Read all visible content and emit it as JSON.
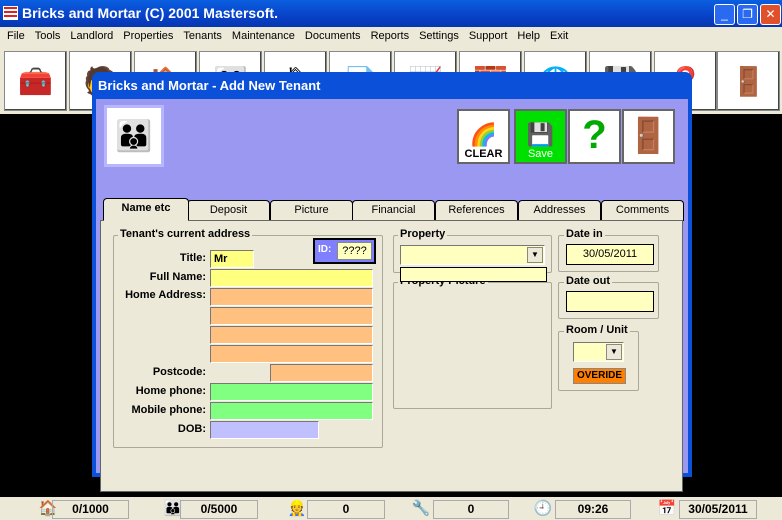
{
  "app": {
    "title": "Bricks and Mortar (C) 2001 Mastersoft."
  },
  "menu": [
    "File",
    "Tools",
    "Landlord",
    "Properties",
    "Tenants",
    "Maintenance",
    "Documents",
    "Reports",
    "Settings",
    "Support",
    "Help",
    "Exit"
  ],
  "toolbar": {
    "icons": [
      "toolbox-icon",
      "landlord-icon",
      "house-icon",
      "tenants-icon",
      "properties-icon",
      "documents-icon",
      "reports-icon",
      "bricks-icon",
      "globe-icon",
      "disk-icon",
      "help-icon",
      "exit-door-icon"
    ]
  },
  "dialog": {
    "title": "Bricks and Mortar - Add New Tenant",
    "buttons": {
      "clear": "CLEAR",
      "save": "Save"
    },
    "tabs": [
      "Name etc",
      "Deposit",
      "Picture",
      "Financial",
      "References",
      "Addresses",
      "Comments"
    ],
    "active_tab": "Name etc",
    "address_group": "Tenant's current address",
    "id_label": "ID:",
    "id_value": "????",
    "labels": {
      "title": "Title:",
      "full_name": "Full Name:",
      "home_address": "Home Address:",
      "postcode": "Postcode:",
      "home_phone": "Home phone:",
      "mobile_phone": "Mobile phone:",
      "dob": "DOB:"
    },
    "values": {
      "title": "Mr",
      "full_name": "",
      "address1": "",
      "address2": "",
      "address3": "",
      "address4": "",
      "postcode": "",
      "home_phone": "",
      "mobile_phone": "",
      "dob": ""
    },
    "property_group": "Property",
    "property_value": "",
    "property_picture": "Property Picture",
    "date_in_label": "Date in",
    "date_in": "30/05/2011",
    "date_out_label": "Date out",
    "date_out": "",
    "room_label": "Room / Unit",
    "room_value": "",
    "override": "OVERIDE"
  },
  "status": [
    {
      "icon": "house-icon",
      "value": "0/1000"
    },
    {
      "icon": "tenants-icon",
      "value": "0/5000"
    },
    {
      "icon": "worker-icon",
      "value": "0"
    },
    {
      "icon": "drill-icon",
      "value": "0"
    },
    {
      "icon": "clock-icon",
      "value": "09:26"
    },
    {
      "icon": "calendar-icon",
      "value": "30/05/2011"
    }
  ]
}
